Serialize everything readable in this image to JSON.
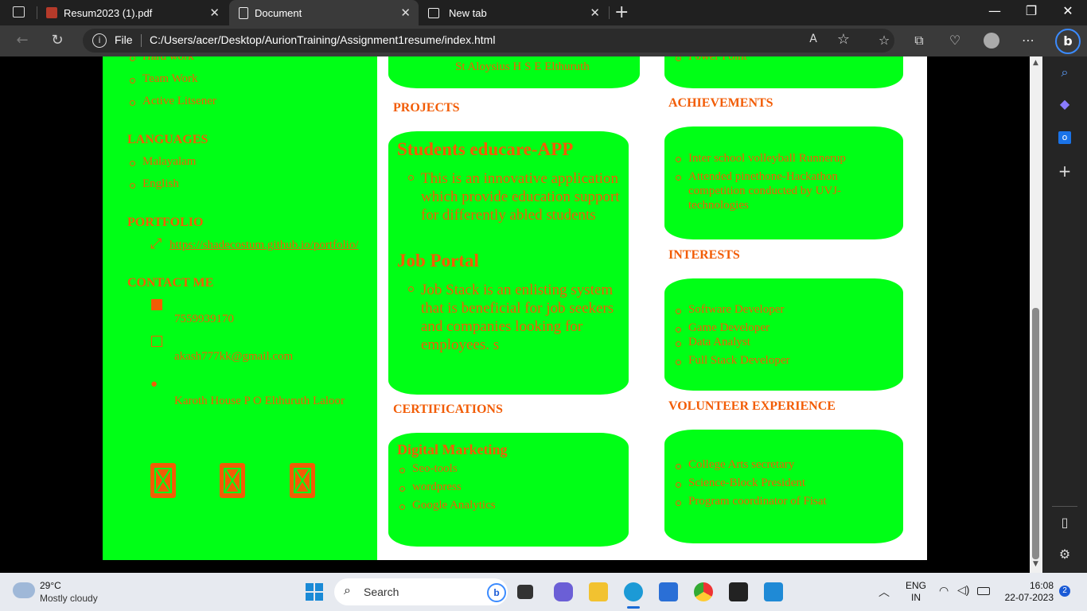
{
  "browser": {
    "tabs": [
      {
        "title": "Resum2023 (1).pdf",
        "icon": "pdf-icon"
      },
      {
        "title": "Document",
        "icon": "document-icon"
      },
      {
        "title": "New tab",
        "icon": "newtab-icon"
      }
    ],
    "address": {
      "protocol_label": "File",
      "url": "C:/Users/acer/Desktop/AurionTraining/Assignment1resume/index.html"
    }
  },
  "resume": {
    "left": {
      "skills_items": [
        "Hard work",
        "Team Work",
        "Active Litsener"
      ],
      "languages_title": "LANGUAGES",
      "languages": [
        "Malayalam",
        "English"
      ],
      "portfolio_title": "PORTFOLIO",
      "portfolio_link": "https://shadecostum.github.io/portfolio/",
      "contact_title": "CONTACT ME",
      "phone": "7559939170",
      "email": "akash777kk@gmail.com",
      "address": "Karoth House P O Elthuruth Laloor"
    },
    "education_fragment": {
      "school": "St Aloysius H S E Elthuruth"
    },
    "skills_fragment": {
      "item": "Power Point"
    },
    "projects": {
      "title": "PROJECTS",
      "items": [
        {
          "name": "Students educare-APP",
          "desc": "This is an innovative application which provide education support for differently abled students"
        },
        {
          "name": "Job Portal",
          "desc": "Job Stack is an enlisting system that is beneficial for job seekers and companies looking for employees. s"
        }
      ]
    },
    "certifications": {
      "title": "CERTIFICATIONS",
      "name": "Digital Marketing",
      "items": [
        "Seo-tools",
        "wordpress",
        "Google Analytics"
      ]
    },
    "achievements": {
      "title": "ACHIEVEMENTS",
      "items": [
        "Inter school volleyball Runnerup",
        "Attended pinethone-Hackathon competition conducted by UVJ-technologies"
      ]
    },
    "interests": {
      "title": "INTERESTS",
      "items": [
        "Software Developer",
        "Game Developer",
        "Data Analyst",
        "Full Stack Developer"
      ]
    },
    "volunteer": {
      "title": "VOLUNTEER EXPERIENCE",
      "items": [
        "College Arts secretary",
        "Science-Block President",
        "Program coordinator of Fisat"
      ]
    }
  },
  "taskbar": {
    "weather_temp": "29°C",
    "weather_desc": "Mostly cloudy",
    "search_placeholder": "Search",
    "lang_line1": "ENG",
    "lang_line2": "IN",
    "time": "16:08",
    "date": "22-07-2023",
    "notification_count": "2"
  },
  "colors": {
    "accent_green": "#00ff16",
    "text_orange": "#f25c05"
  }
}
